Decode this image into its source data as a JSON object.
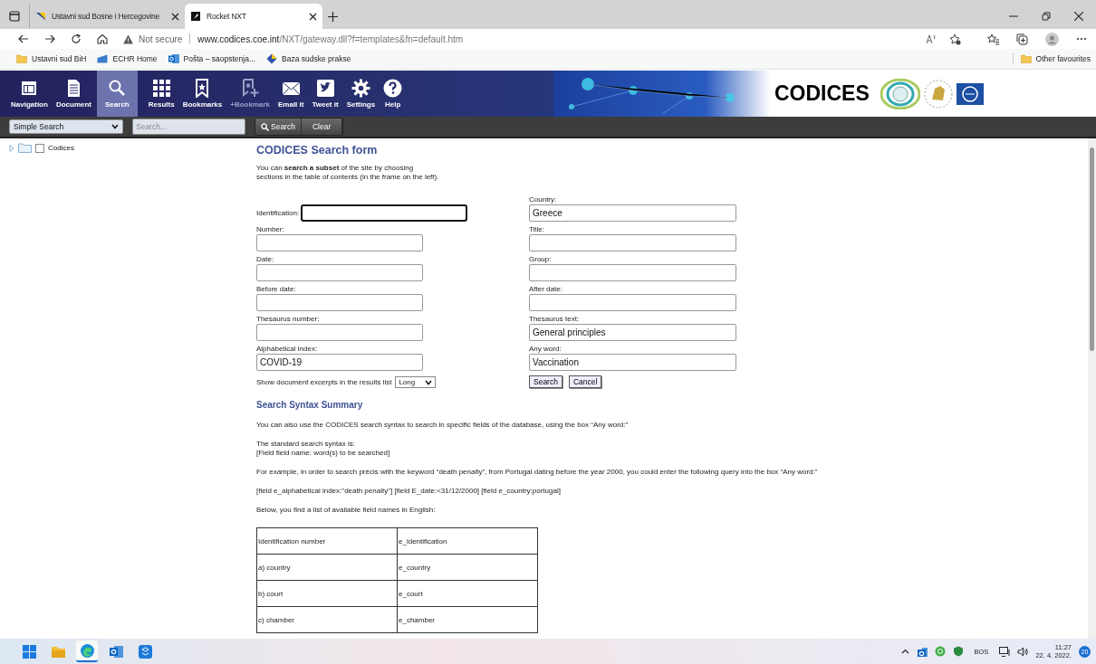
{
  "browser": {
    "tabs": [
      {
        "title": "Ustavni sud Bosne i Hercegovine",
        "kind": "flag",
        "selected": false
      },
      {
        "title": "Rocket NXT",
        "kind": "rocket",
        "selected": true
      }
    ],
    "address": {
      "security": "Not secure",
      "host": "www.codices.coe.int",
      "path": "/NXT/gateway.dll?f=templates&fn=default.htm"
    },
    "bookmarks": [
      {
        "label": "Ustavni sud BiH",
        "kind": "folder"
      },
      {
        "label": "ECHR Home",
        "kind": "echr"
      },
      {
        "label": "Pošta – saopstenja...",
        "kind": "outlook"
      },
      {
        "label": "Baza sudske prakse",
        "kind": "diamond"
      }
    ],
    "other_favourites": "Other favourites"
  },
  "app": {
    "toolbar": [
      {
        "label": "Navigation",
        "kind": "navigation",
        "selected": false,
        "disabled": false
      },
      {
        "label": "Document",
        "kind": "document",
        "selected": false,
        "disabled": false
      },
      {
        "label": "Search",
        "kind": "search",
        "selected": true,
        "disabled": false
      },
      {
        "label": "Results",
        "kind": "results",
        "selected": false,
        "disabled": false
      },
      {
        "label": "Bookmarks",
        "kind": "bookmarks",
        "selected": false,
        "disabled": false
      },
      {
        "label": "+Bookmark",
        "kind": "addbookmark",
        "selected": false,
        "disabled": true
      },
      {
        "label": "Email it",
        "kind": "email",
        "selected": false,
        "disabled": false
      },
      {
        "label": "Tweet it",
        "kind": "tweet",
        "selected": false,
        "disabled": false
      },
      {
        "label": "Settings",
        "kind": "settings",
        "selected": false,
        "disabled": false
      },
      {
        "label": "Help",
        "kind": "help",
        "selected": false,
        "disabled": false
      }
    ],
    "banner_title": "CODICES",
    "search_bar": {
      "mode": "Simple Search",
      "placeholder": "Search...",
      "buttons": [
        "Search",
        "Clear"
      ]
    },
    "tree": [
      {
        "label": "Codices",
        "checked": false,
        "expanded": false
      }
    ]
  },
  "form": {
    "title": "CODICES Search form",
    "intro": "You can **search a subset** of the site by choosing\nsections in the table of contents (in the frame on the left).",
    "left_fields": [
      {
        "label": "Identification:",
        "focused": true
      },
      {
        "label": "Number:",
        "focused": false
      },
      {
        "label": "Date:",
        "focused": false
      },
      {
        "label": "Before date:",
        "focused": false
      },
      {
        "label": "Thesaurus number:",
        "focused": false
      },
      {
        "label": "Alphabetical index:",
        "value": "COVID-19",
        "focused": false
      }
    ],
    "right_fields": [
      {
        "label": "Country:",
        "value": "Greece",
        "focused": false
      },
      {
        "label": "Title:",
        "focused": false
      },
      {
        "label": "Group:",
        "focused": false
      },
      {
        "label": "After date:",
        "focused": false
      },
      {
        "label": "Thesaurus text:",
        "value": "General principles",
        "focused": false
      },
      {
        "label": "Any word:",
        "value": "Vaccination",
        "focused": false
      }
    ],
    "excerpts": {
      "label": "Show document excerpts in the results list",
      "value": "Long"
    },
    "buttons": [
      "Search",
      "Cancel"
    ]
  },
  "syntax": {
    "heading": "Search Syntax Summary",
    "paragraphs": [
      "You can also use the CODICES search syntax to search in specific fields of the database, using the box “Any word:”",
      "The standard search syntax is:\n[Field field name: word(s) to be searched]",
      "For example, in order to search précis with the keyword “death penalty”, from Portugal dating before the year 2000, you could enter the following query into the box “Any word:”",
      "[field e_alphabetical index:\"death penalty\"] [field E_date:<31/12/2000] [field e_country:portugal]",
      "Below, you find a list of available field names in English:"
    ],
    "table": [
      [
        "Identification number",
        "e_identification"
      ],
      [
        "a) country",
        "e_country"
      ],
      [
        "b) court",
        "e_court"
      ],
      [
        "c) chamber",
        "e_chamber"
      ]
    ]
  },
  "taskbar": {
    "apps": [
      {
        "kind": "start",
        "selected": false
      },
      {
        "kind": "explorer",
        "selected": false
      },
      {
        "kind": "edge",
        "selected": true
      },
      {
        "kind": "outlook",
        "selected": false
      },
      {
        "kind": "app",
        "selected": false
      }
    ],
    "language": "BOS",
    "time": "11:27",
    "date": "22. 4. 2022.",
    "notifications": "20"
  }
}
